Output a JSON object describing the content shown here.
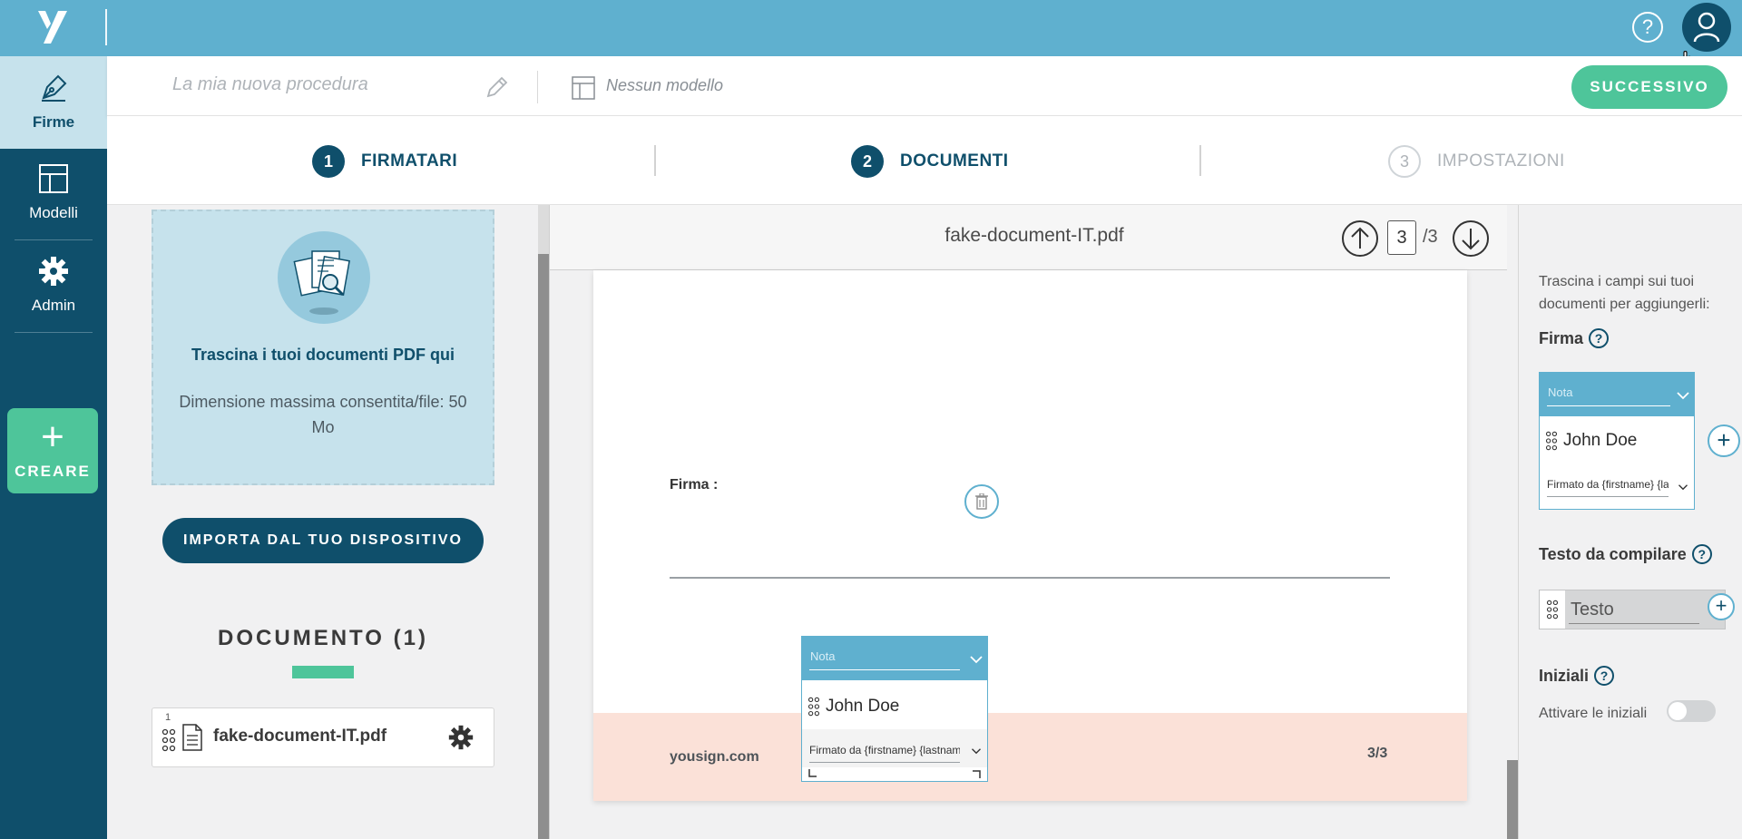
{
  "topbar": {
    "help": "?"
  },
  "nav": {
    "items": [
      {
        "label": "Firme"
      },
      {
        "label": "Modelli"
      },
      {
        "label": "Admin"
      }
    ],
    "create_label": "CREARE",
    "create_plus": "+"
  },
  "procedure": {
    "name_placeholder": "La mia nuova procedura",
    "model_label": "Nessun modello",
    "next_label": "SUCCESSIVO"
  },
  "steps": [
    {
      "number": "1",
      "label": "FIRMATARI",
      "state": "done"
    },
    {
      "number": "2",
      "label": "DOCUMENTI",
      "state": "active"
    },
    {
      "number": "3",
      "label": "IMPOSTAZIONI",
      "state": "inactive"
    }
  ],
  "upload": {
    "title": "Trascina i tuoi documenti PDF qui",
    "subtitle": "Dimensione massima consentita/file: 50 Mo",
    "import_label": "IMPORTA DAL TUO DISPOSITIVO",
    "doc_heading": "DOCUMENTO (1)"
  },
  "documents": [
    {
      "index": "1",
      "filename": "fake-document-IT.pdf"
    }
  ],
  "viewer": {
    "title": "fake-document-IT.pdf",
    "current_page": "3",
    "total_pages": "/3",
    "page": {
      "firma_label": "Firma :",
      "footer_brand": "yousign.com",
      "footer_page": "3/3"
    },
    "field": {
      "nota_placeholder": "Nota",
      "signer": "John Doe",
      "signed_by": "Firmato da {firstname} {lastname}"
    }
  },
  "right_panel": {
    "hint": "Trascina i campi sui tuoi documenti per aggiungerli:",
    "firma_title": "Firma",
    "firma_field": {
      "nota_placeholder": "Nota",
      "signer": "John Doe",
      "signed_by": "Firmato da {firstname} {lastname}"
    },
    "testo_title": "Testo da compilare",
    "testo_placeholder": "Testo",
    "iniziali_title": "Iniziali",
    "iniziali_toggle_label": "Attivare le iniziali",
    "iniziali_enabled": false,
    "qmark": "?",
    "plus": "+"
  },
  "colors": {
    "topbar": "#5fb0cf",
    "nav": "#0f4f6b",
    "accent_green": "#4ec59a",
    "dropzone": "#c6e2ec",
    "footer": "#fbe1d8"
  },
  "icons": [
    "logo-icon",
    "help-icon",
    "user-icon",
    "pen-icon",
    "template-icon",
    "gear-icon",
    "plus-icon",
    "pencil-icon",
    "document-search-icon",
    "grip-icon",
    "file-icon",
    "arrow-up-icon",
    "arrow-down-icon",
    "chevron-down-icon",
    "trash-icon"
  ]
}
